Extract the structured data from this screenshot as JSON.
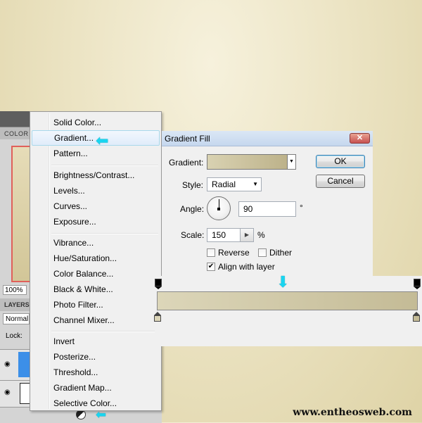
{
  "colors": {
    "highlight_border": "#a8d8eb",
    "arrow": "#19d5f0",
    "gradient_start": "#dcd6b9",
    "gradient_end": "#c4bb96"
  },
  "left_panel": {
    "color_tab": "COLOR",
    "zoom": "100%",
    "layers_tab": "LAYERS",
    "blend_mode": "Normal",
    "lock_label": "Lock:"
  },
  "menu": {
    "items": [
      "Solid Color...",
      "Gradient...",
      "Pattern...",
      "Brightness/Contrast...",
      "Levels...",
      "Curves...",
      "Exposure...",
      "Vibrance...",
      "Hue/Saturation...",
      "Color Balance...",
      "Black & White...",
      "Photo Filter...",
      "Channel Mixer...",
      "Invert",
      "Posterize...",
      "Threshold...",
      "Gradient Map...",
      "Selective Color..."
    ],
    "highlighted": "Gradient..."
  },
  "dialog": {
    "title": "Gradient Fill",
    "close_icon": "close-icon",
    "gradient_label": "Gradient:",
    "style_label": "Style:",
    "style_value": "Radial",
    "angle_label": "Angle:",
    "angle_value": "90",
    "angle_unit": "°",
    "scale_label": "Scale:",
    "scale_value": "150",
    "scale_unit": "%",
    "reverse_label": "Reverse",
    "reverse_checked": false,
    "dither_label": "Dither",
    "dither_checked": false,
    "align_label": "Align with layer",
    "align_checked": true,
    "ok_label": "OK",
    "cancel_label": "Cancel"
  },
  "watermark": "www.entheosweb.com"
}
